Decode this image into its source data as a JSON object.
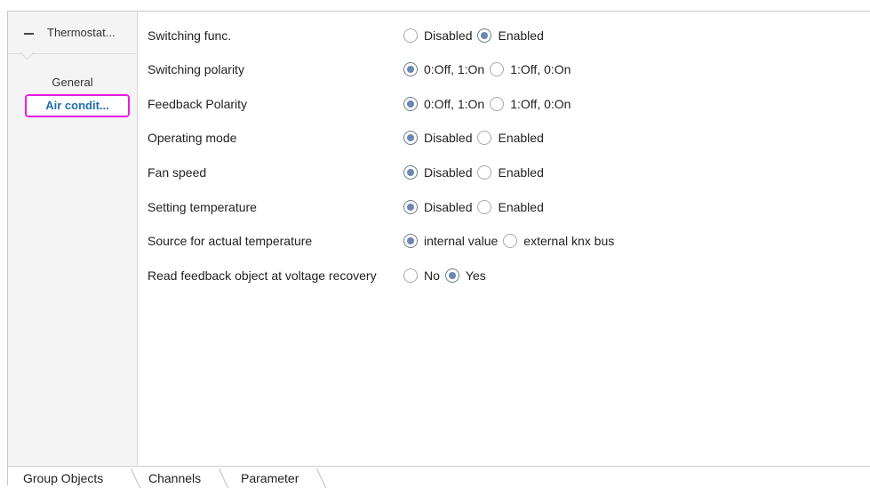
{
  "sidebar": {
    "group_title": "Thermostat...",
    "items": [
      {
        "label": "General"
      },
      {
        "label": "Air condit..."
      }
    ]
  },
  "params": [
    {
      "label": "Switching func.",
      "options": [
        "Disabled",
        "Enabled"
      ],
      "selected": 1
    },
    {
      "label": "Switching polarity",
      "options": [
        "0:Off, 1:On",
        "1:Off, 0:On"
      ],
      "selected": 0
    },
    {
      "label": "Feedback Polarity",
      "options": [
        "0:Off, 1:On",
        "1:Off, 0:On"
      ],
      "selected": 0
    },
    {
      "label": "Operating mode",
      "options": [
        "Disabled",
        "Enabled"
      ],
      "selected": 0
    },
    {
      "label": "Fan speed",
      "options": [
        "Disabled",
        "Enabled"
      ],
      "selected": 0
    },
    {
      "label": "Setting temperature",
      "options": [
        "Disabled",
        "Enabled"
      ],
      "selected": 0
    },
    {
      "label": "Source for actual temperature",
      "options": [
        "internal value",
        "external knx bus"
      ],
      "selected": 0
    },
    {
      "label": "Read feedback object at voltage recovery",
      "options": [
        "No",
        "Yes"
      ],
      "selected": 1
    }
  ],
  "tabs": [
    {
      "label": "Group Objects"
    },
    {
      "label": "Channels"
    },
    {
      "label": "Parameter"
    }
  ],
  "colors": {
    "highlight_border": "#e81de6",
    "active_text": "#1f6fb2",
    "radio_dot": "#6b87b5"
  }
}
